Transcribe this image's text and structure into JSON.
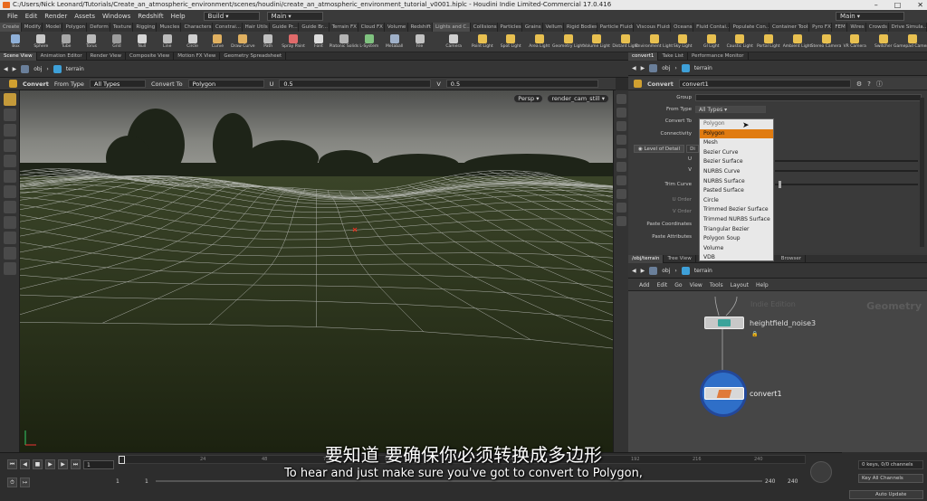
{
  "window": {
    "title": "C:/Users/Nick Leonard/Tutorials/Create_an_atmospheric_environment/scenes/houdini/create_an_atmospheric_environment_tutorial_v0001.hiplc - Houdini Indie Limited-Commercial 17.0.416",
    "buttons": [
      "–",
      "□",
      "✕"
    ]
  },
  "menubar": {
    "items": [
      "File",
      "Edit",
      "Render",
      "Assets",
      "Windows",
      "Redshift",
      "Help"
    ],
    "build_label": "Build",
    "main_label": "Main",
    "desktop_label": "Main"
  },
  "shelf_tabs_left": [
    "Create",
    "Modify",
    "Model",
    "Polygon",
    "Deform",
    "Texture",
    "Rigging",
    "Muscles",
    "Characters",
    "Constrai...",
    "Hair Utils",
    "Guide Pr...",
    "Guide Br...",
    "Terrain FX",
    "Cloud FX",
    "Volume",
    "Redshift"
  ],
  "shelf_tabs_right": [
    "Lights and C...",
    "Collisions",
    "Particles",
    "Grains",
    "Vellum",
    "Rigid Bodies",
    "Particle Fluids",
    "Viscous Fluids",
    "Oceans",
    "Fluid Contai...",
    "Populate Con...",
    "Container Tools",
    "Pyro FX",
    "FEM",
    "Wires",
    "Crowds",
    "Drive Simula..."
  ],
  "shelf_tools_left": [
    "Box",
    "Sphere",
    "Tube",
    "Torus",
    "Grid",
    "Null",
    "Line",
    "Circle",
    "Curve",
    "Draw Curve",
    "Path",
    "Spray Paint",
    "Font",
    "Platonic Solids",
    "L-System",
    "Metaball",
    "File"
  ],
  "shelf_tools_right": [
    "Camera",
    "Point Light",
    "Spot Light",
    "Area Light",
    "Geometry Light",
    "Volume Light",
    "Distant Light",
    "Environment Light",
    "Sky Light",
    "GI Light",
    "Caustic Light",
    "Portal Light",
    "Ambient Light",
    "Stereo Camera",
    "VR Camera",
    "Switcher",
    "Gamepad Camera"
  ],
  "left_pane_tabs": [
    "Scene View",
    "Animation Editor",
    "Render View",
    "Composite View",
    "Motion FX View",
    "Geometry Spreadsheet"
  ],
  "right_pane_tabs": [
    "convert1",
    "Take List",
    "Performance Monitor"
  ],
  "path_left": {
    "context": "obj",
    "node": "terrain"
  },
  "path_right": {
    "context": "obj",
    "node": "terrain"
  },
  "opbar": {
    "node_label": "Convert",
    "from_type_label": "From Type",
    "from_type_value": "All Types",
    "convert_to_label": "Convert To",
    "convert_to_value": "Polygon",
    "u_label": "U",
    "u_value": "0.5",
    "v_label": "V",
    "v_value": "0.5"
  },
  "viewport": {
    "persp_label": "Persp",
    "camera_label": "render_cam_still"
  },
  "params": {
    "header_type": "Convert",
    "header_name": "convert1",
    "rows": [
      {
        "label": "Group",
        "value": ""
      },
      {
        "label": "From Type",
        "value": "All Types"
      },
      {
        "label": "Convert To",
        "value": "Polygon"
      },
      {
        "label": "Connectivity",
        "value": ""
      }
    ],
    "tab_lod": "Level of Detail",
    "tab_div": "Di",
    "lower_labels": [
      "U",
      "V",
      "Trim Curve",
      "U Order",
      "V Order",
      "Paste Coordinates",
      "Paste Attributes"
    ]
  },
  "dropdown": {
    "options": [
      "Polygon",
      "Polygon",
      "Mesh",
      "Bezier Curve",
      "Bezier Surface",
      "NURBS Curve",
      "NURBS Surface",
      "Pasted Surface",
      "Circle",
      "Trimmed Bezier Surface",
      "Trimmed NURBS Surface",
      "Triangular Bezier",
      "Polygon Soup",
      "Volume",
      "VDB"
    ],
    "selected_index": 1
  },
  "network": {
    "tabs": [
      "/obj/terrain",
      "Tree View",
      "Browser"
    ],
    "menu": [
      "Add",
      "Edit",
      "Go",
      "View",
      "Tools",
      "Layout",
      "Help"
    ],
    "watermark_edition": "Indie Edition",
    "watermark_context": "Geometry",
    "nodes": [
      {
        "name": "heightfield_noise3"
      },
      {
        "name": "convert1"
      }
    ]
  },
  "timeline": {
    "frame_current": "1",
    "ticks": [
      "24",
      "48",
      "72",
      "96",
      "120",
      "144",
      "168",
      "192",
      "216",
      "240"
    ],
    "start_a": "1",
    "start_b": "1",
    "end_a": "240",
    "end_b": "240"
  },
  "right_bottom": {
    "keys": "0 keys, 0/0 channels",
    "key_all": "Key All Channels",
    "auto_update": "Auto Update"
  },
  "subtitles": {
    "chinese": "要知道 要确保你必须转换成多边形",
    "english": "To hear and just make sure you've got to convert to Polygon,"
  }
}
